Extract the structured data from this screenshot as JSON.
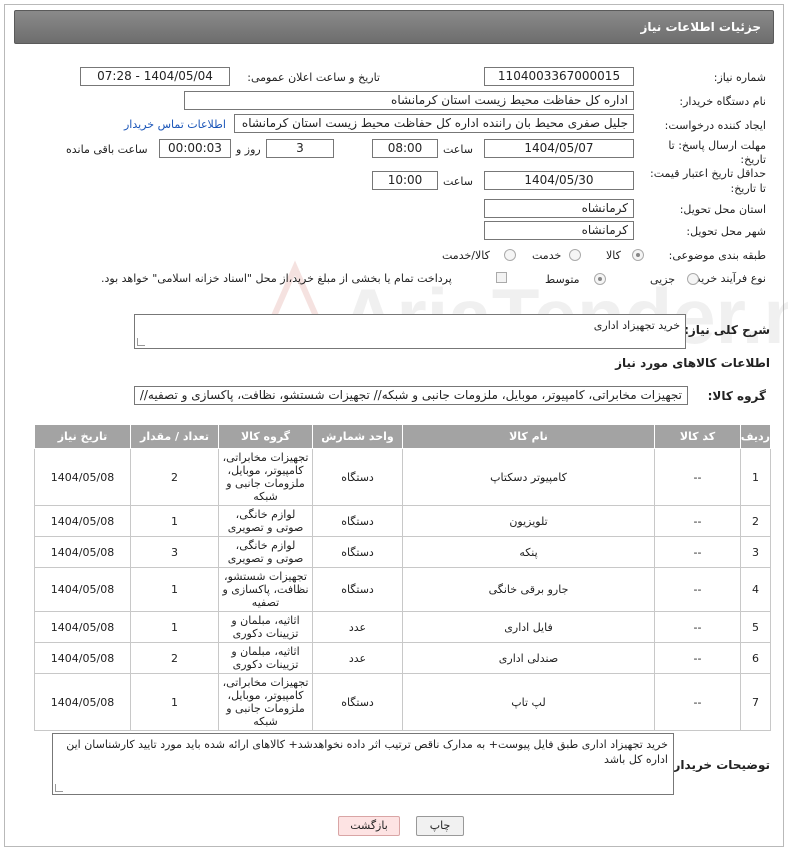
{
  "header": {
    "title": "جزئیات اطلاعات نیاز"
  },
  "form": {
    "need_number_label": "شماره نیاز:",
    "need_number": "1104003367000015",
    "announce_label": "تاریخ و ساعت اعلان عمومی:",
    "announce_value": "1404/05/04 - 07:28",
    "buyer_org_label": "نام دستگاه خریدار:",
    "buyer_org": "اداره کل حفاظت محیط زیست استان کرمانشاه",
    "creator_label": "ایجاد کننده درخواست:",
    "creator": "جلیل  صفری محیط بان راننده اداره کل حفاظت محیط زیست استان کرمانشاه",
    "contact_link": "اطلاعات تماس خریدار",
    "deadline_label_1": "مهلت ارسال پاسخ: تا",
    "deadline_label_2": "تاریخ:",
    "deadline_date": "1404/05/07",
    "time_label": "ساعت",
    "deadline_time": "08:00",
    "days_value": "3",
    "days_label": "روز و",
    "remaining_time": "00:00:03",
    "remaining_label": "ساعت باقی مانده",
    "validity_label_1": "حداقل تاریخ اعتبار قیمت:",
    "validity_label_2": "تا تاریخ:",
    "validity_date": "1404/05/30",
    "validity_time": "10:00",
    "province_label": "استان محل تحویل:",
    "province": "کرمانشاه",
    "city_label": "شهر محل تحویل:",
    "city": "کرمانشاه",
    "category_label": "طبقه بندی موضوعی:",
    "category_options": [
      "کالا",
      "خدمت",
      "کالا/خدمت"
    ],
    "category_selected": "کالا",
    "process_label": "نوع فرآیند خرید :",
    "process_options": [
      "جزیی",
      "متوسط"
    ],
    "process_selected": "متوسط",
    "payment_note": "پرداخت تمام یا بخشی از مبلغ خرید،از محل \"اسناد خزانه اسلامی\" خواهد بود."
  },
  "summary": {
    "label": "شرح کلی نیاز:",
    "value": "خرید تجهیزاد اداری"
  },
  "goods_section": {
    "title": "اطلاعات کالاهای مورد نیاز",
    "group_label": "گروه کالا:",
    "group_value": "تجهیزات مخابراتی، کامپیوتر، موبایل، ملزومات جانبی و شبکه// تجهیزات شستشو، نظافت، پاکسازی و تصفیه//"
  },
  "table": {
    "headers": [
      "ردیف",
      "کد کالا",
      "نام کالا",
      "واحد شمارش",
      "گروه کالا",
      "تعداد / مقدار",
      "تاریخ نیاز"
    ],
    "rows": [
      {
        "row": "1",
        "code": "--",
        "name": "کامپیوتر دسکتاپ",
        "unit": "دستگاه",
        "group": [
          "تجهیزات مخابراتی،",
          "کامپیوتر، موبایل،",
          "ملزومات جانبی و",
          "شبکه"
        ],
        "qty": "2",
        "date": "1404/05/08"
      },
      {
        "row": "2",
        "code": "--",
        "name": "تلویزیون",
        "unit": "دستگاه",
        "group": [
          "لوازم خانگی،",
          "صوتی و تصویری"
        ],
        "qty": "1",
        "date": "1404/05/08"
      },
      {
        "row": "3",
        "code": "--",
        "name": "پنکه",
        "unit": "دستگاه",
        "group": [
          "لوازم خانگی،",
          "صوتی و تصویری"
        ],
        "qty": "3",
        "date": "1404/05/08"
      },
      {
        "row": "4",
        "code": "--",
        "name": "جارو برقی خانگی",
        "unit": "دستگاه",
        "group": [
          "تجهیزات شستشو،",
          "نظافت، پاکسازی و",
          "تصفیه"
        ],
        "qty": "1",
        "date": "1404/05/08"
      },
      {
        "row": "5",
        "code": "--",
        "name": "فایل اداری",
        "unit": "عدد",
        "group": [
          "اثاثیه، مبلمان و",
          "تزیینات دکوری"
        ],
        "qty": "1",
        "date": "1404/05/08"
      },
      {
        "row": "6",
        "code": "--",
        "name": "صندلی اداری",
        "unit": "عدد",
        "group": [
          "اثاثیه، مبلمان و",
          "تزیینات دکوری"
        ],
        "qty": "2",
        "date": "1404/05/08"
      },
      {
        "row": "7",
        "code": "--",
        "name": "لپ تاپ",
        "unit": "دستگاه",
        "group": [
          "تجهیزات مخابراتی،",
          "کامپیوتر، موبایل،",
          "ملزومات جانبی و",
          "شبکه"
        ],
        "qty": "1",
        "date": "1404/05/08"
      }
    ]
  },
  "buyer_notes": {
    "label": "توضیحات خریدار:",
    "value": "خرید تجهیزاد اداری طبق فایل پیوست+ به مدارک ناقص ترتیب اثر داده نخواهدشد+ کالاهای ارائه شده باید مورد تایید کارشناسان این اداره کل باشد"
  },
  "buttons": {
    "print": "چاپ",
    "back": "بازگشت"
  },
  "watermark": {
    "text": "AriaTender.neT"
  },
  "colors": {
    "header_bg": "#7b7b7b",
    "table_header_bg": "#a3a3a3",
    "link": "#1a55b8",
    "back_button_bg": "#fde3e3"
  }
}
